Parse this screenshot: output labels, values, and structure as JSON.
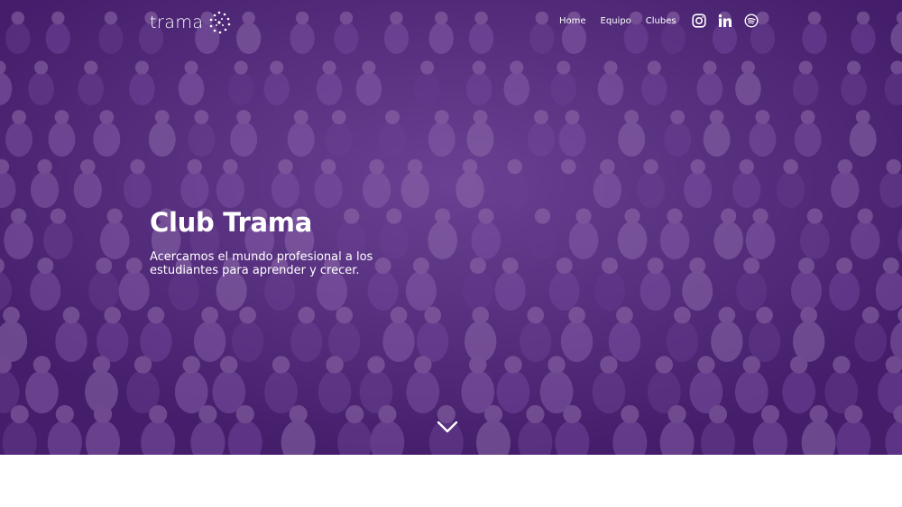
{
  "brand": {
    "logo_text": "trama"
  },
  "nav": {
    "links": [
      {
        "label": "Home"
      },
      {
        "label": "Equipo"
      },
      {
        "label": "Clubes"
      }
    ],
    "social_icons": [
      "instagram-icon",
      "linkedin-icon",
      "spotify-icon"
    ]
  },
  "hero": {
    "title": "Club Trama",
    "subtitle": "Acercamos el mundo profesional a los estudiantes para aprender y crecer.",
    "scroll_icon": "chevron-down-icon"
  },
  "colors": {
    "overlay": "#4c2378",
    "text": "#ffffff",
    "page_background": "#ffffff"
  }
}
